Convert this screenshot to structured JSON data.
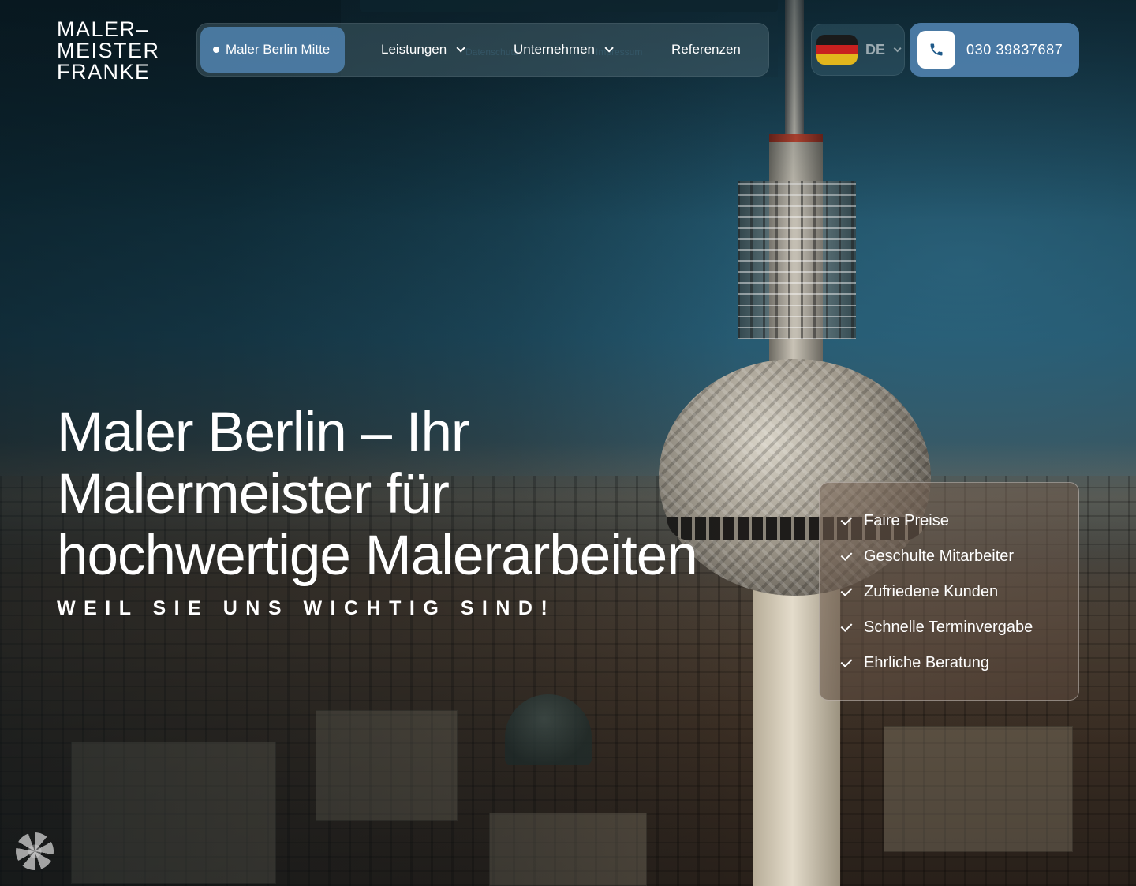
{
  "brand": {
    "logo_lines": [
      "MALER–",
      "MEISTER",
      "FRANKE"
    ]
  },
  "nav": {
    "active_item": "Maler Berlin Mitte",
    "items": [
      {
        "label": "Leistungen",
        "has_dropdown": true
      },
      {
        "label": "Unternehmen",
        "has_dropdown": true
      },
      {
        "label": "Referenzen",
        "has_dropdown": false
      }
    ],
    "ghost_links": [
      "Datenschutz",
      "Impressum"
    ]
  },
  "language": {
    "code": "DE",
    "flag_colors": [
      "#1a1a1a",
      "#c8201f",
      "#e2b61c"
    ]
  },
  "contact": {
    "phone": "030 39837687",
    "icon": "phone-icon"
  },
  "hero": {
    "title_lines": [
      "Maler Berlin – Ihr",
      "Malermeister für",
      "hochwertige Malerarbeiten"
    ],
    "subtitle": "WEIL SIE UNS WICHTIG SIND!"
  },
  "features": [
    "Faire Preise",
    "Geschulte Mitarbeiter",
    "Zufriedene Kunden",
    "Schnelle Terminvergabe",
    "Ehrliche Beratung"
  ],
  "colors": {
    "accent": "#5082af",
    "text": "#ffffff"
  }
}
